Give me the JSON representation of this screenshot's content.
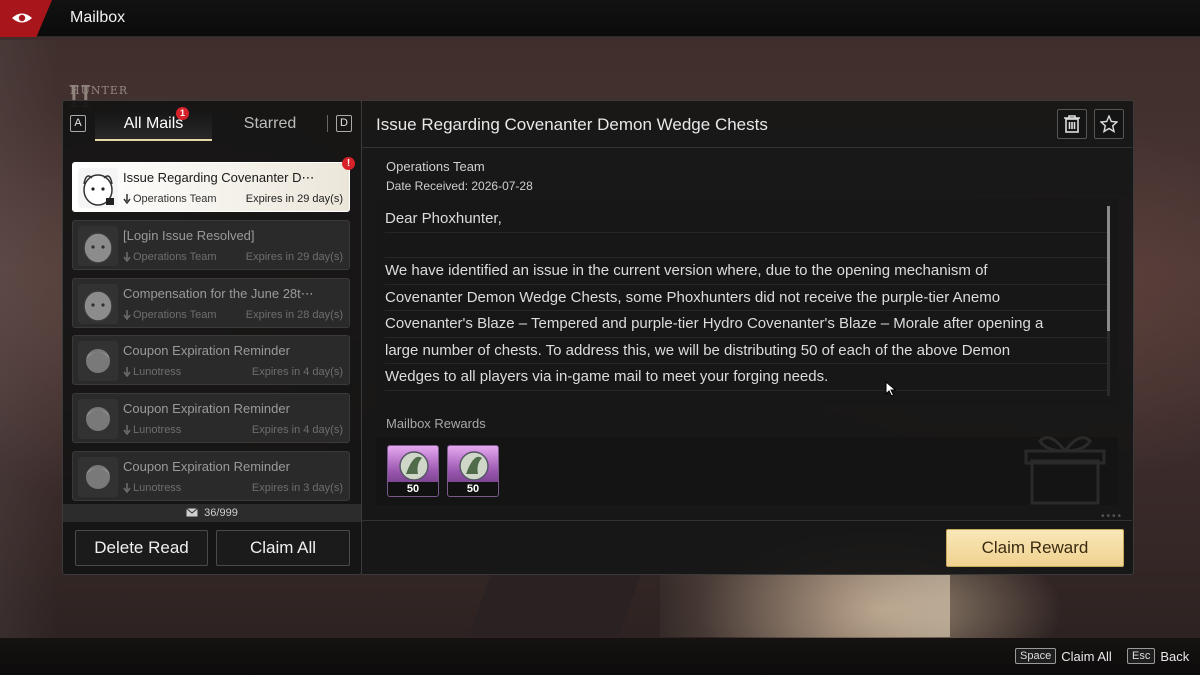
{
  "header": {
    "title": "Mailbox"
  },
  "emblem": {
    "roman": "II",
    "text": "HUNTER"
  },
  "tabs": {
    "left_key": "A",
    "right_key": "D",
    "all_mails": "All Mails",
    "all_mails_badge": "1",
    "starred": "Starred"
  },
  "mails": [
    {
      "subject": "Issue Regarding Covenanter D⋯",
      "sender": "Operations Team",
      "expiry": "Expires in 29 day(s)",
      "badge": "!"
    },
    {
      "subject": "[Login Issue Resolved]",
      "sender": "Operations Team",
      "expiry": "Expires in 29 day(s)"
    },
    {
      "subject": "Compensation for the June 28t⋯",
      "sender": "Operations Team",
      "expiry": "Expires in 28 day(s)"
    },
    {
      "subject": "Coupon Expiration Reminder",
      "sender": "Lunotress",
      "expiry": "Expires in 4 day(s)"
    },
    {
      "subject": "Coupon Expiration Reminder",
      "sender": "Lunotress",
      "expiry": "Expires in 4 day(s)"
    },
    {
      "subject": "Coupon Expiration Reminder",
      "sender": "Lunotress",
      "expiry": "Expires in 3 day(s)"
    }
  ],
  "mail_count": "36/999",
  "buttons": {
    "delete_read": "Delete Read",
    "claim_all": "Claim All",
    "claim_reward": "Claim Reward"
  },
  "detail": {
    "title": "Issue Regarding Covenanter Demon Wedge Chests",
    "sender": "Operations Team",
    "date_received": "Date Received: 2026-07-28",
    "body_lines": [
      "Dear Phoxhunter,",
      "",
      "We have identified an issue in the current version where, due to the opening mechanism of",
      "Covenanter Demon Wedge Chests, some Phoxhunters did not receive the purple-tier Anemo",
      "Covenanter's Blaze – Tempered and purple-tier Hydro Covenanter's Blaze – Morale after opening a",
      "large number of chests. To address this, we will be distributing 50 of each of the above Demon",
      "Wedges to all players via in-game mail to meet your forging needs."
    ],
    "rewards_label": "Mailbox Rewards",
    "rewards": [
      {
        "qty": "50"
      },
      {
        "qty": "50"
      }
    ]
  },
  "hints": [
    {
      "key": "Space",
      "label": "Claim All"
    },
    {
      "key": "Esc",
      "label": "Back"
    }
  ],
  "icons": {
    "back": "back-eye-icon",
    "delete": "trash-icon",
    "star": "star-icon",
    "mail": "envelope-icon"
  },
  "colors": {
    "accent": "#a8161b",
    "badge": "#d8222a",
    "claim": "#f0d290"
  }
}
